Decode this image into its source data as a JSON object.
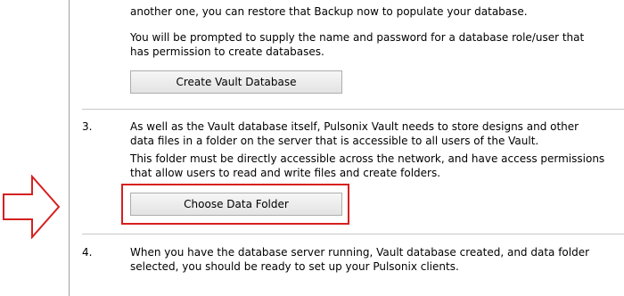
{
  "colors": {
    "highlight_border": "#d62020",
    "arrow_outline": "#d62020"
  },
  "section_top": {
    "line1": "another one, you can restore that Backup now to populate your database.",
    "line2": "You will be prompted to supply the name and password for a database role/user that",
    "line3": "has permission to create databases.",
    "button_label": "Create Vault Database"
  },
  "step3": {
    "number": "3.",
    "line1": "As well as the Vault database itself, Pulsonix Vault needs to store designs and other",
    "line2": "data files in a folder on the server that is accessible to all users of the Vault.",
    "line3": "This folder must be directly accessible across the network, and have access permissions",
    "line4": "that allow users to read and write files and create folders.",
    "button_label": "Choose Data Folder"
  },
  "step4": {
    "number": "4.",
    "line1": "When you have the database server running, Vault database created, and data folder",
    "line2": "selected, you should be ready to set up your Pulsonix clients."
  },
  "arrow_icon": "right-arrow-outline-icon"
}
